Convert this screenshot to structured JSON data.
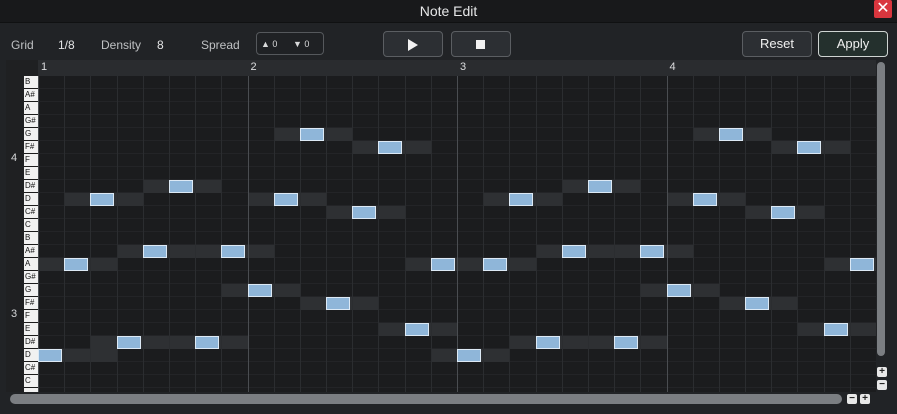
{
  "window": {
    "title": "Note Edit",
    "close_label": "✕"
  },
  "toolbar": {
    "grid_label": "Grid",
    "grid_value": "1/8",
    "density_label": "Density",
    "density_value": "8",
    "spread_label": "Spread",
    "spread_up": "▲ 0",
    "spread_down": "▼ 0",
    "play_icon": "play-icon",
    "stop_icon": "stop-icon",
    "reset_label": "Reset",
    "apply_label": "Apply"
  },
  "ruler": {
    "bars": [
      "1",
      "2",
      "3",
      "4"
    ]
  },
  "octave_labels": [
    "4",
    "3"
  ],
  "keys": [
    "B",
    "A#",
    "A",
    "G#",
    "G",
    "F#",
    "F",
    "E",
    "D#",
    "D",
    "C#",
    "C",
    "B",
    "A#",
    "A",
    "G#",
    "G",
    "F#",
    "F",
    "E",
    "D#",
    "D",
    "C#",
    "C"
  ],
  "grid": {
    "beats_per_bar": 8,
    "bars": 4
  },
  "notes": [
    {
      "key": 21,
      "beat": 0
    },
    {
      "key": 14,
      "beat": 1
    },
    {
      "key": 9,
      "beat": 2
    },
    {
      "key": 20,
      "beat": 3
    },
    {
      "key": 13,
      "beat": 4
    },
    {
      "key": 8,
      "beat": 5
    },
    {
      "key": 13,
      "beat": 7
    },
    {
      "key": 20,
      "beat": 6
    },
    {
      "key": 16,
      "beat": 8
    },
    {
      "key": 9,
      "beat": 9
    },
    {
      "key": 4,
      "beat": 10
    },
    {
      "key": 17,
      "beat": 11
    },
    {
      "key": 10,
      "beat": 12
    },
    {
      "key": 5,
      "beat": 13
    },
    {
      "key": 19,
      "beat": 14
    },
    {
      "key": 14,
      "beat": 15
    },
    {
      "key": 21,
      "beat": 16
    },
    {
      "key": 14,
      "beat": 17
    },
    {
      "key": 9,
      "beat": 18
    },
    {
      "key": 20,
      "beat": 19
    },
    {
      "key": 13,
      "beat": 20
    },
    {
      "key": 8,
      "beat": 21
    },
    {
      "key": 20,
      "beat": 22
    },
    {
      "key": 13,
      "beat": 23
    },
    {
      "key": 16,
      "beat": 24
    },
    {
      "key": 9,
      "beat": 25
    },
    {
      "key": 4,
      "beat": 26
    },
    {
      "key": 17,
      "beat": 27
    },
    {
      "key": 10,
      "beat": 28
    },
    {
      "key": 5,
      "beat": 29
    },
    {
      "key": 19,
      "beat": 30
    },
    {
      "key": 14,
      "beat": 31
    }
  ],
  "colors": {
    "note": "#8fb6d9",
    "apply_border": "#cfd4d2",
    "close": "#d9363e"
  }
}
